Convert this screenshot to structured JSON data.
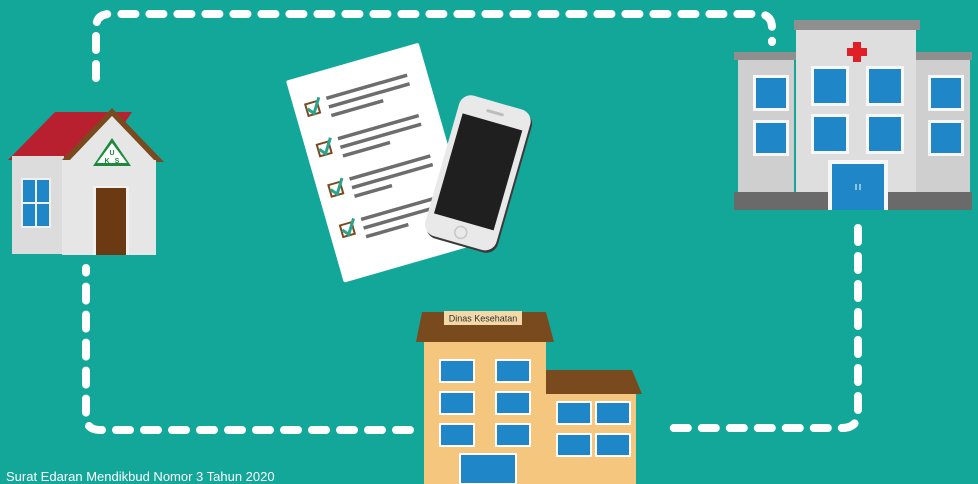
{
  "colors": {
    "background": "#13a79a",
    "route_dash": "#ffffff",
    "house_roof": "#b8202f",
    "house_wall": "#dcdcdc",
    "hospital_wall": "#d6d6d6",
    "hospital_cross": "#e02028",
    "office_wall": "#f5c77e",
    "office_roof": "#7a4a1f",
    "window_blue": "#1f86c8",
    "checkmark": "#2aa38f"
  },
  "icons": {
    "school_house": "house-icon",
    "uks_emblem": "triangle-emblem-icon",
    "checklist_document": "checklist-icon",
    "smartphone": "smartphone-icon",
    "hospital": "hospital-icon",
    "health_office": "office-building-icon"
  },
  "uks_letters": [
    "U",
    "K",
    "S"
  ],
  "health_office_sign": "Dinas Kesehatan",
  "source": {
    "label_fragment": "r:",
    "text": "Surat Edaran Mendikbud Nomor 3 Tahun 2020"
  }
}
